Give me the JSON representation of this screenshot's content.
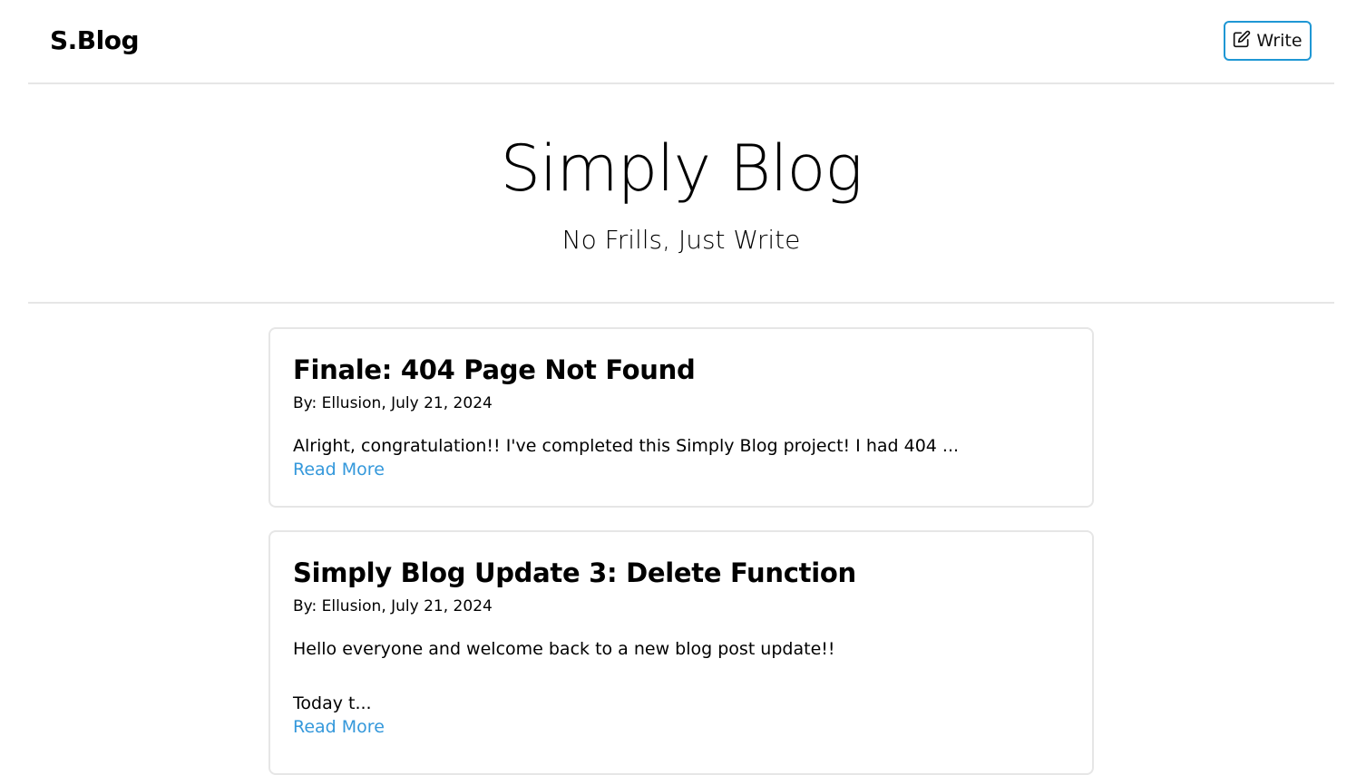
{
  "nav": {
    "brand": "S.Blog",
    "write_label": "Write",
    "write_icon": "edit-icon",
    "accent_color": "#1f97d4"
  },
  "hero": {
    "title": "Simply Blog",
    "subtitle": "No Frills, Just Write"
  },
  "posts": [
    {
      "title": "Finale: 404 Page Not Found",
      "meta": "By: Ellusion, July 21, 2024",
      "excerpt": "Alright, congratulation!! I've completed this Simply Blog project! I had 404 ...",
      "read_more": "Read More"
    },
    {
      "title": "Simply Blog Update 3: Delete Function",
      "meta": "By: Ellusion, July 21, 2024",
      "excerpt": "Hello everyone and welcome back to a new blog post update!!\n\nToday t...",
      "read_more": "Read More"
    }
  ],
  "link_color": "#3498db"
}
